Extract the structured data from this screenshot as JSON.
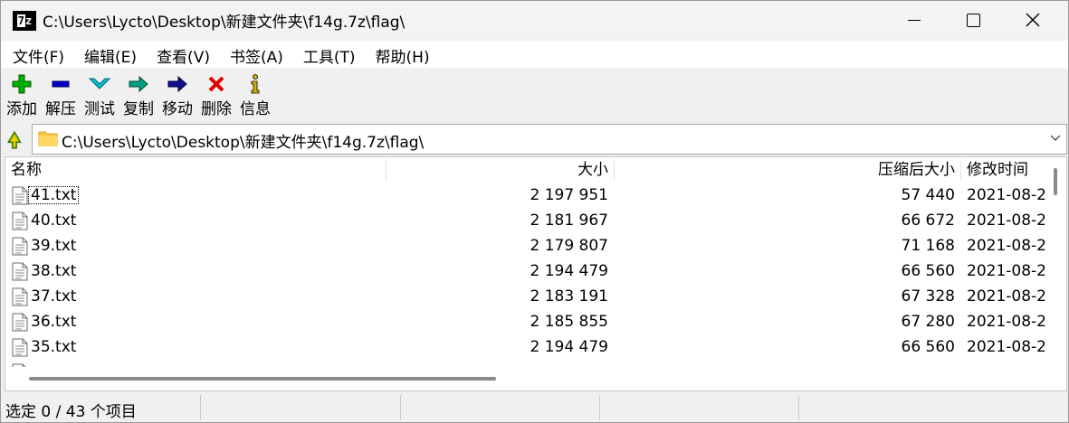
{
  "window": {
    "title": "C:\\Users\\Lycto\\Desktop\\新建文件夹\\f14g.7z\\flag\\",
    "app_icon_text": "7z"
  },
  "menu": [
    "文件(F)",
    "编辑(E)",
    "查看(V)",
    "书签(A)",
    "工具(T)",
    "帮助(H)"
  ],
  "toolbar": [
    {
      "label": "添加",
      "icon": "add-icon",
      "color": "#00b000"
    },
    {
      "label": "解压",
      "icon": "extract-icon",
      "color": "#0000c8"
    },
    {
      "label": "测试",
      "icon": "test-icon",
      "color": "#00a8c8"
    },
    {
      "label": "复制",
      "icon": "copy-icon",
      "color": "#008a70"
    },
    {
      "label": "移动",
      "icon": "move-icon",
      "color": "#101090"
    },
    {
      "label": "删除",
      "icon": "delete-icon",
      "color": "#e00000"
    },
    {
      "label": "信息",
      "icon": "info-icon",
      "color": "#c8a800"
    }
  ],
  "address": {
    "path": "C:\\Users\\Lycto\\Desktop\\新建文件夹\\f14g.7z\\flag\\"
  },
  "columns": {
    "name": "名称",
    "size": "大小",
    "packed": "压缩后大小",
    "modified": "修改时间"
  },
  "files": [
    {
      "name": "41.txt",
      "size": "2 197 951",
      "packed": "57 440",
      "modified": "2021-08-2"
    },
    {
      "name": "40.txt",
      "size": "2 181 967",
      "packed": "66 672",
      "modified": "2021-08-2"
    },
    {
      "name": "39.txt",
      "size": "2 179 807",
      "packed": "71 168",
      "modified": "2021-08-2"
    },
    {
      "name": "38.txt",
      "size": "2 194 479",
      "packed": "66 560",
      "modified": "2021-08-2"
    },
    {
      "name": "37.txt",
      "size": "2 183 191",
      "packed": "67 328",
      "modified": "2021-08-2"
    },
    {
      "name": "36.txt",
      "size": "2 185 855",
      "packed": "67 280",
      "modified": "2021-08-2"
    },
    {
      "name": "35.txt",
      "size": "2 194 479",
      "packed": "66 560",
      "modified": "2021-08-2"
    }
  ],
  "status": "选定 0 / 43 个项目"
}
